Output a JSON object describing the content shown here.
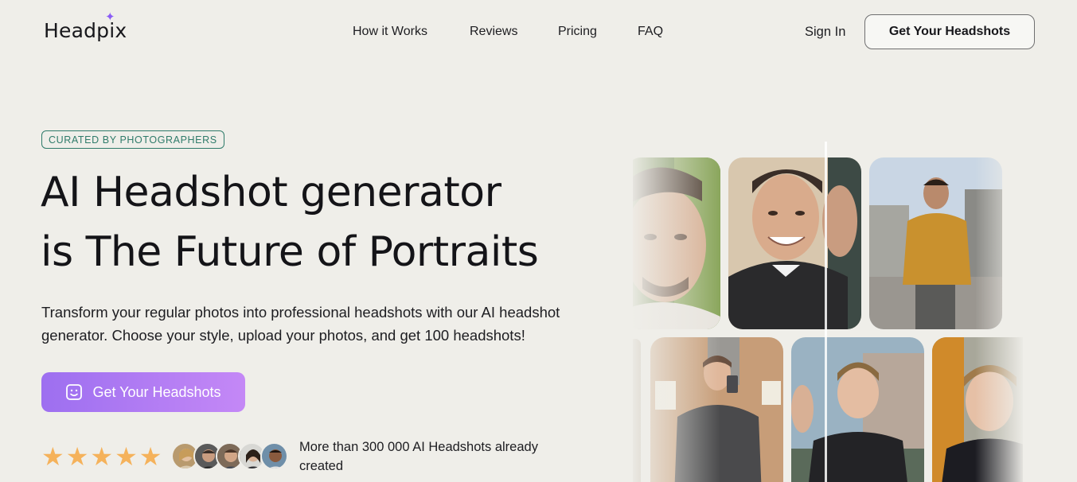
{
  "header": {
    "logo": "Headpix",
    "nav": [
      "How it Works",
      "Reviews",
      "Pricing",
      "FAQ"
    ],
    "signin_label": "Sign In",
    "cta_label": "Get Your Headshots"
  },
  "hero": {
    "badge": "CURATED BY PHOTOGRAPHERS",
    "title_line1": "AI Headshot generator",
    "title_line2": "is The Future of Portraits",
    "subtitle": "Transform your regular photos into professional headshots with our AI headshot generator. Choose your style, upload your photos, and get 100 headshots!",
    "cta_label": "Get Your Headshots",
    "rating_stars": 5,
    "social_proof": "More than 300 000 AI Headshots already created"
  },
  "colors": {
    "background": "#efeee9",
    "accent_purple": "#9d6ff0",
    "badge_green": "#2f7b6a",
    "star_orange": "#f5b25b"
  }
}
